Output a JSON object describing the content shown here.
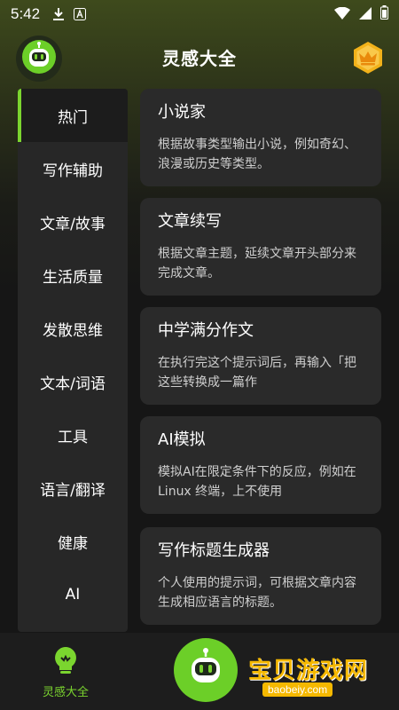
{
  "status_bar": {
    "time": "5:42",
    "icons": [
      "download-icon",
      "font-icon",
      "wifi-icon",
      "signal-icon",
      "battery-icon"
    ]
  },
  "header": {
    "title": "灵感大全",
    "avatar_icon": "robot-icon",
    "premium_icon": "crown-icon"
  },
  "colors": {
    "accent": "#7bd52f",
    "background": "#161616",
    "card": "#2a2a2a",
    "sidebar": "#272727"
  },
  "sidebar": {
    "items": [
      {
        "label": "热门",
        "active": true
      },
      {
        "label": "写作辅助"
      },
      {
        "label": "文章/故事"
      },
      {
        "label": "生活质量"
      },
      {
        "label": "发散思维"
      },
      {
        "label": "文本/词语"
      },
      {
        "label": "工具"
      },
      {
        "label": "语言/翻译"
      },
      {
        "label": "健康"
      },
      {
        "label": "AI"
      }
    ]
  },
  "cards": [
    {
      "title": "小说家",
      "desc": "根据故事类型输出小说，例如奇幻、浪漫或历史等类型。"
    },
    {
      "title": "文章续写",
      "desc": "根据文章主题，延续文章开头部分来完成文章。"
    },
    {
      "title": "中学满分作文",
      "desc": "在执行完这个提示词后，再输入「把这些转换成一篇作"
    },
    {
      "title": "AI模拟",
      "desc": "模拟AI在限定条件下的反应，例如在Linux 终端，上不使用"
    },
    {
      "title": "写作标题生成器",
      "desc": "个人使用的提示词，可根据文章内容生成相应语言的标题。"
    }
  ],
  "bottom_nav": {
    "home_label": "灵感大全",
    "home_icon": "lightbulb-icon",
    "center_icon": "robot-icon"
  },
  "watermark": {
    "text": "宝贝游戏网",
    "url": "baobeiy.com"
  }
}
